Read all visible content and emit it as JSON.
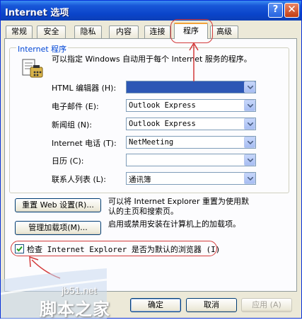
{
  "window": {
    "title": "Internet 选项",
    "help_glyph": "?",
    "close_glyph": "✕"
  },
  "tabs": [
    {
      "label": "常规"
    },
    {
      "label": "安全"
    },
    {
      "label": "隐私"
    },
    {
      "label": "内容"
    },
    {
      "label": "连接"
    },
    {
      "label": "程序",
      "active": true
    },
    {
      "label": "高级"
    }
  ],
  "group": {
    "title": "Internet 程序",
    "icon": "programs-icon",
    "description": "可以指定 Windows 自动用于每个 Internet 服务的程序。"
  },
  "programs": [
    {
      "label": "HTML 编辑器 (H):",
      "value": ""
    },
    {
      "label": "电子邮件 (E):",
      "value": "Outlook Express"
    },
    {
      "label": "新闻组 (N):",
      "value": "Outlook Express"
    },
    {
      "label": "Internet 电话 (T):",
      "value": "NetMeeting"
    },
    {
      "label": "日历 (C):",
      "value": ""
    },
    {
      "label": "联系人列表 (L):",
      "value": "通讯簿"
    }
  ],
  "reset_web": {
    "button": "重置 Web 设置(R)...",
    "text_line1": "可以将 Internet Explorer 重置为使用默",
    "text_line2": "认的主页和搜索页。"
  },
  "manage_addons": {
    "button": "管理加载项(M)...",
    "text": "启用或禁用安装在计算机上的加载项。"
  },
  "default_browser_check": {
    "label": "检查 Internet Explorer 是否为默认的浏览器 (I)",
    "checked": true
  },
  "footer": {
    "ok": "确定",
    "cancel": "取消",
    "apply": "应用 (A)"
  },
  "watermark": {
    "line1": "jb51.net",
    "line2": "脚本之家"
  },
  "colors": {
    "title_bar": "#0a44c9",
    "annotation": "#d33a3a",
    "selection": "#2d57b5"
  }
}
